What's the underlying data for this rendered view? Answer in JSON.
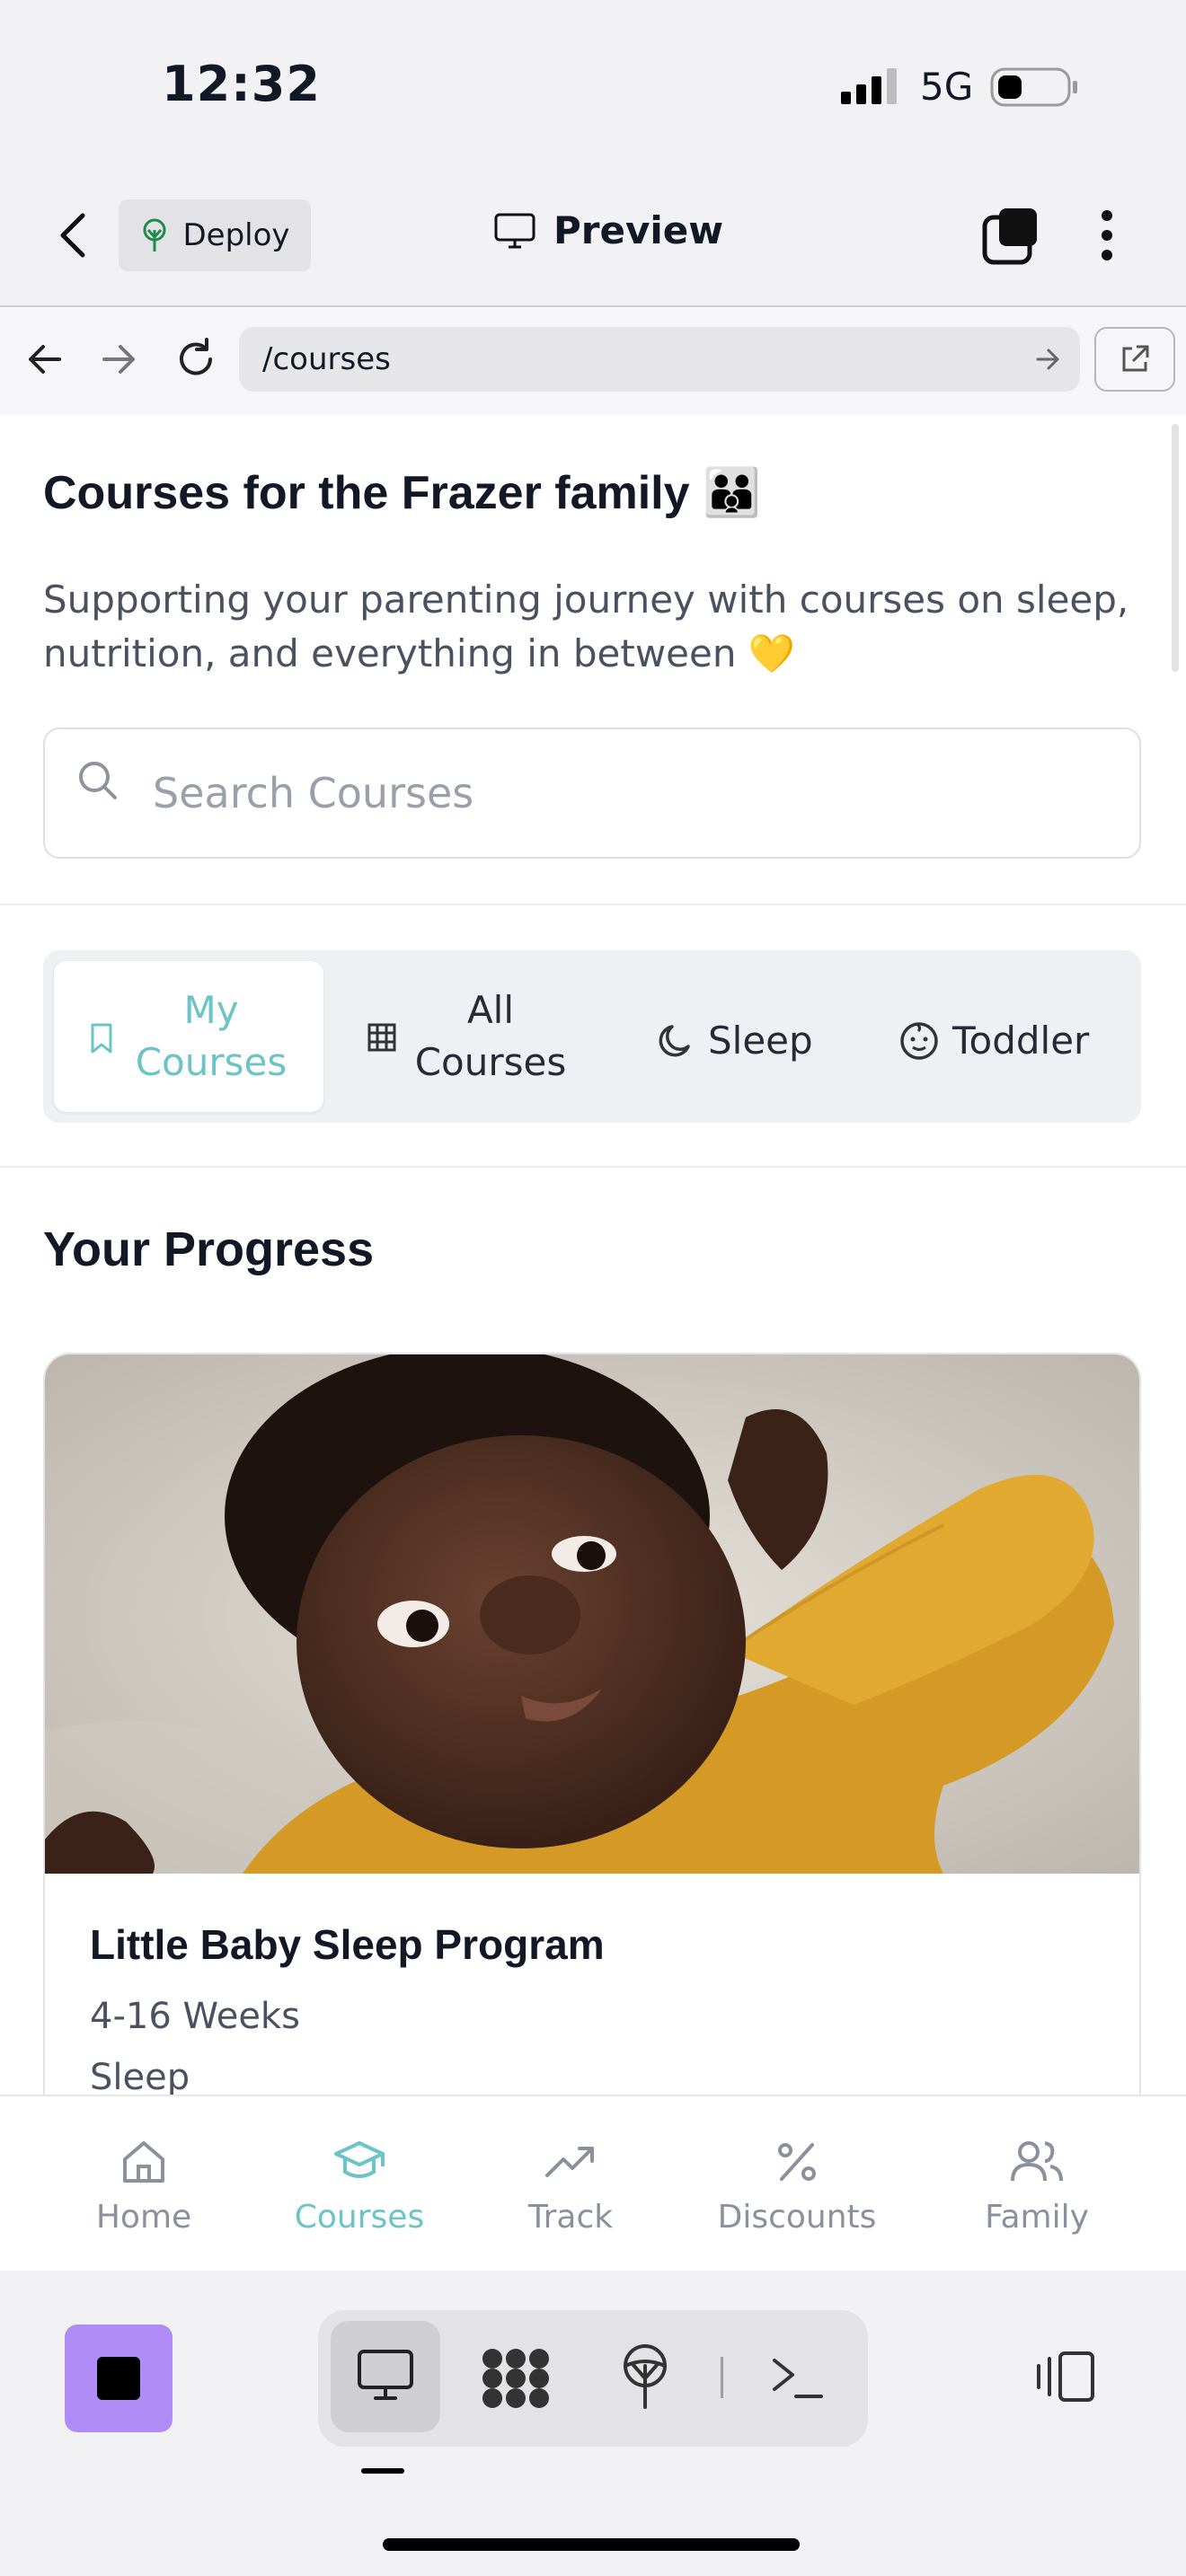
{
  "status_bar": {
    "time": "12:32",
    "network": "5G"
  },
  "header": {
    "deploy_label": "Deploy",
    "preview_label": "Preview"
  },
  "browser": {
    "url": "/courses"
  },
  "page": {
    "title": "Courses for the Frazer family 👪",
    "subtitle": "Supporting your parenting journey with courses on sleep, nutrition, and everything in between 💛",
    "search": {
      "placeholder": "Search Courses"
    },
    "tabs": [
      {
        "label_line1": "My",
        "label_line2": "Courses",
        "icon": "bookmark-icon",
        "active": true
      },
      {
        "label_line1": "All",
        "label_line2": "Courses",
        "icon": "grid-icon",
        "active": false
      },
      {
        "label": "Sleep",
        "icon": "moon-icon",
        "active": false
      },
      {
        "label": "Toddler",
        "icon": "baby-face-icon",
        "active": false
      }
    ],
    "progress_title": "Your Progress",
    "course": {
      "title": "Little Baby Sleep Program",
      "age_range": "4-16 Weeks",
      "category": "Sleep"
    }
  },
  "bottom_nav": [
    {
      "label": "Home",
      "icon": "home-icon",
      "active": false
    },
    {
      "label": "Courses",
      "icon": "graduation-cap-icon",
      "active": true
    },
    {
      "label": "Track",
      "icon": "trending-up-icon",
      "active": false
    },
    {
      "label": "Discounts",
      "icon": "percent-icon",
      "active": false
    },
    {
      "label": "Family",
      "icon": "users-icon",
      "active": false
    }
  ],
  "colors": {
    "accent": "#6cc4c6",
    "stop_button": "#b08cf7",
    "yellow_shirt": "#e2a930"
  }
}
